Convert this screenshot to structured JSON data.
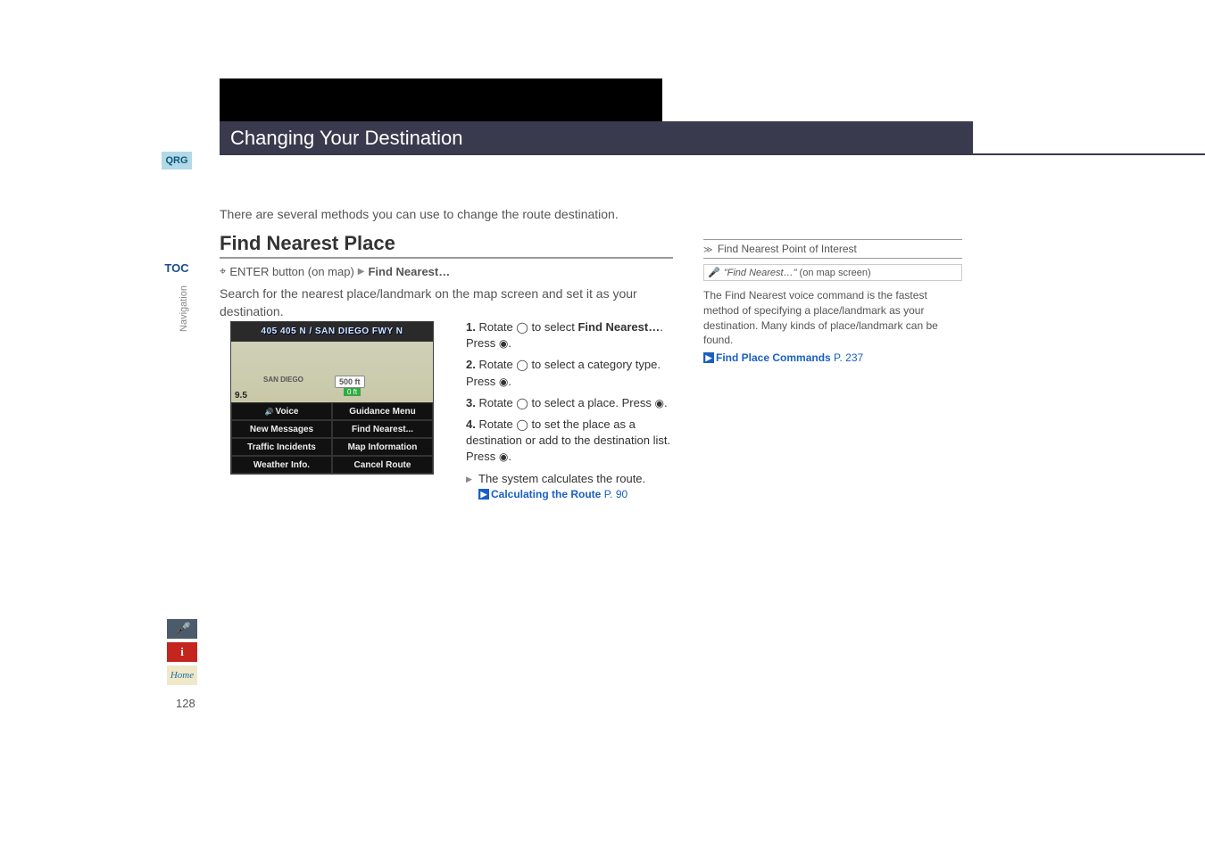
{
  "header": {
    "title": "Changing Your Destination"
  },
  "sidebar": {
    "qrg": "QRG",
    "toc": "TOC",
    "nav_label": "Navigation"
  },
  "intro": "There are several methods you can use to change the route destination.",
  "section": {
    "title": "Find Nearest Place",
    "breadcrumb_prefix": "ENTER button (on map)",
    "breadcrumb_item": "Find Nearest…",
    "search_text": "Search for the nearest place/landmark on the map screen and set it as your destination."
  },
  "screenshot": {
    "road": "405 405 N / SAN DIEGO FWY N",
    "badge1": "500 ft",
    "badge2": "0 ft",
    "corner": "9.5",
    "san_diego": "SAN DIEGO",
    "menu": {
      "voice": "Voice",
      "guidance": "Guidance Menu",
      "messages": "New Messages",
      "find_nearest": "Find Nearest...",
      "traffic": "Traffic Incidents",
      "map_info": "Map Information",
      "weather": "Weather Info.",
      "cancel": "Cancel Route"
    }
  },
  "steps": [
    {
      "num": "1.",
      "pre": "Rotate ",
      "mid": " to select ",
      "bold": "Find Nearest…",
      "post": ". Press ",
      "end": "."
    },
    {
      "num": "2.",
      "pre": "Rotate ",
      "mid": " to select a category type. Press ",
      "end": "."
    },
    {
      "num": "3.",
      "pre": "Rotate ",
      "mid": " to select a place. Press ",
      "end": "."
    },
    {
      "num": "4.",
      "pre": "Rotate ",
      "mid": " to set the place as a destination or add to the destination list. Press ",
      "end": "."
    }
  ],
  "substep": {
    "text": "The system calculates the route.",
    "link_text": "Calculating the Route",
    "link_page": "P. 90"
  },
  "right": {
    "title": "Find Nearest Point of Interest",
    "voice_cmd": "\"Find Nearest…\"",
    "voice_suffix": " (on map screen)",
    "body": "The Find Nearest voice command is the fastest method of specifying a place/landmark as your destination. Many kinds of place/landmark can be found.",
    "link_text": "Find Place Commands",
    "link_page": "P. 237"
  },
  "bottom": {
    "voice": "𝄐",
    "info": "i",
    "home": "Home"
  },
  "page_number": "128"
}
